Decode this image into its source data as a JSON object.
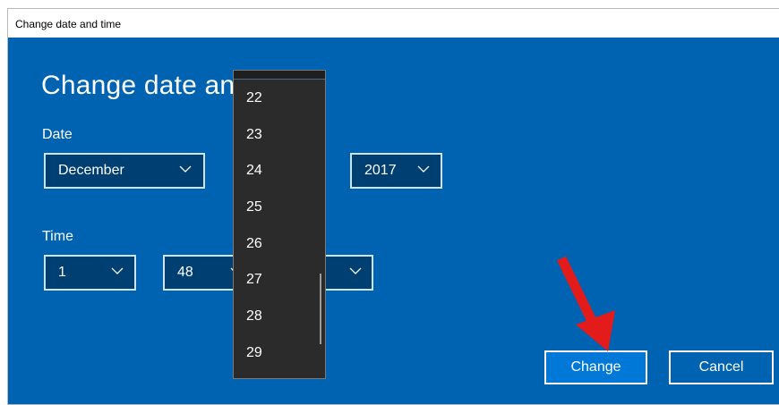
{
  "window": {
    "title": "Change date and time"
  },
  "heading": "Change date and",
  "date": {
    "label": "Date",
    "month": "December",
    "year": "2017"
  },
  "time": {
    "label": "Time",
    "hour": "1",
    "minute": "48"
  },
  "day_dropdown": {
    "items": [
      "22",
      "23",
      "24",
      "25",
      "26",
      "27",
      "28",
      "29"
    ]
  },
  "buttons": {
    "change": "Change",
    "cancel": "Cancel"
  },
  "colors": {
    "accent": "#0063b1",
    "button": "#0078d7",
    "dropdown": "#2b2b2b",
    "annotation_arrow": "#e31b1b"
  },
  "icons": {
    "combo": "chevron-down-icon",
    "annotation": "red-arrow"
  }
}
